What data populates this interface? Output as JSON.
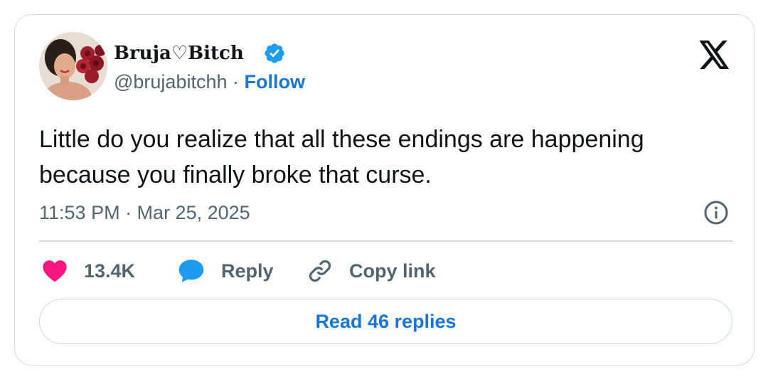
{
  "tweet": {
    "author": {
      "display_name": "Bruja♡Bitch",
      "handle": "@brujabitchh",
      "separator": "·",
      "follow_label": "Follow",
      "verified": true
    },
    "text": "Little do you realize that all these endings are happening because you finally broke that curse.",
    "timestamp": "11:53 PM · Mar 25, 2025"
  },
  "actions": {
    "likes": "13.4K",
    "reply_label": "Reply",
    "copy_link_label": "Copy link"
  },
  "read_replies_label": "Read 46 replies",
  "icons": {
    "logo": "x-logo-icon",
    "verified": "verified-badge-icon",
    "info": "info-icon",
    "like": "heart-icon",
    "reply": "speech-bubble-icon",
    "copy_link": "link-icon"
  },
  "colors": {
    "accent": "#1976d2",
    "like": "#f91880",
    "reply": "#1d9bf0",
    "muted": "#536471",
    "text": "#0f1419",
    "verified": "#1d9bf0"
  }
}
